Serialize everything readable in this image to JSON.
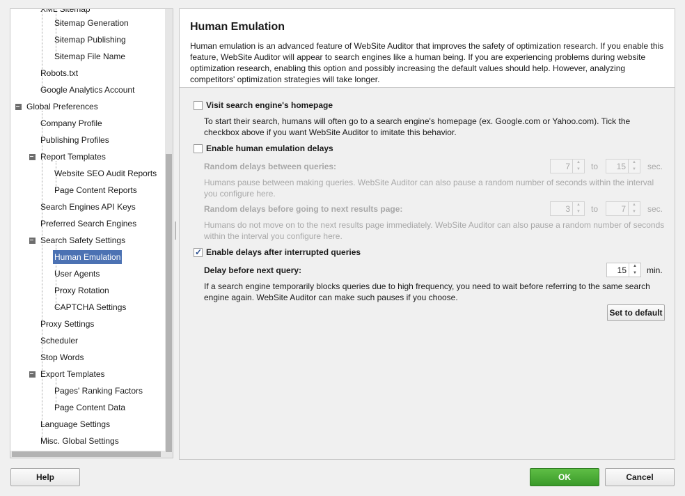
{
  "tree": {
    "items": [
      {
        "label": "XML Sitemap"
      },
      {
        "label": "Sitemap Generation"
      },
      {
        "label": "Sitemap Publishing"
      },
      {
        "label": "Sitemap File Name"
      },
      {
        "label": "Robots.txt"
      },
      {
        "label": "Google Analytics Account"
      },
      {
        "label": "Global Preferences"
      },
      {
        "label": "Company Profile"
      },
      {
        "label": "Publishing Profiles"
      },
      {
        "label": "Report Templates"
      },
      {
        "label": "Website SEO Audit Reports"
      },
      {
        "label": "Page Content Reports"
      },
      {
        "label": "Search Engines API Keys"
      },
      {
        "label": "Preferred Search Engines"
      },
      {
        "label": "Search Safety Settings"
      },
      {
        "label": "Human Emulation"
      },
      {
        "label": "User Agents"
      },
      {
        "label": "Proxy Rotation"
      },
      {
        "label": "CAPTCHA Settings"
      },
      {
        "label": "Proxy Settings"
      },
      {
        "label": "Scheduler"
      },
      {
        "label": "Stop Words"
      },
      {
        "label": "Export Templates"
      },
      {
        "label": "Pages' Ranking Factors"
      },
      {
        "label": "Page Content Data"
      },
      {
        "label": "Language Settings"
      },
      {
        "label": "Misc. Global Settings"
      }
    ],
    "selected": "Human Emulation"
  },
  "content": {
    "title": "Human Emulation",
    "description": "Human emulation is an advanced feature of WebSite Auditor that improves the safety of optimization research. If you enable this feature, WebSite Auditor will appear to search engines like a human being. If you are experiencing problems during website optimization research, enabling this option and possibly increasing the default values should help. However, analyzing competitors' optimization strategies will take longer.",
    "visit_homepage": {
      "label": "Visit search engine's homepage",
      "checked": false,
      "help": "To start their search, humans will often go to a search engine's homepage (ex. Google.com or Yahoo.com). Tick the checkbox above if you want WebSite Auditor to imitate this behavior."
    },
    "delays": {
      "label": "Enable human emulation delays",
      "checked": false,
      "between_queries": {
        "label": "Random delays between queries:",
        "from": "7",
        "to_word": "to",
        "to": "15",
        "unit": "sec.",
        "help": "Humans pause between making queries. WebSite Auditor can also pause a random number of seconds within the interval you configure here."
      },
      "next_page": {
        "label": "Random delays before going to next results page:",
        "from": "3",
        "to_word": "to",
        "to": "7",
        "unit": "sec.",
        "help": "Humans do not move on to the next results page immediately. WebSite Auditor can also pause a random number of seconds within the interval you configure here."
      }
    },
    "interrupted": {
      "label": "Enable delays after interrupted queries",
      "checked": true,
      "delay_label": "Delay before next query:",
      "delay_value": "15",
      "delay_unit": "min.",
      "help": "If a search engine  temporarily blocks queries due to high frequency, you need to wait before referring to the same search engine again. WebSite Auditor can make such pauses if you choose."
    },
    "set_default_label": "Set to default"
  },
  "footer": {
    "help_label": "Help",
    "ok_label": "OK",
    "cancel_label": "Cancel"
  },
  "colors": {
    "selection": "#4c72b3",
    "ok_button": "#3a9a2a"
  }
}
